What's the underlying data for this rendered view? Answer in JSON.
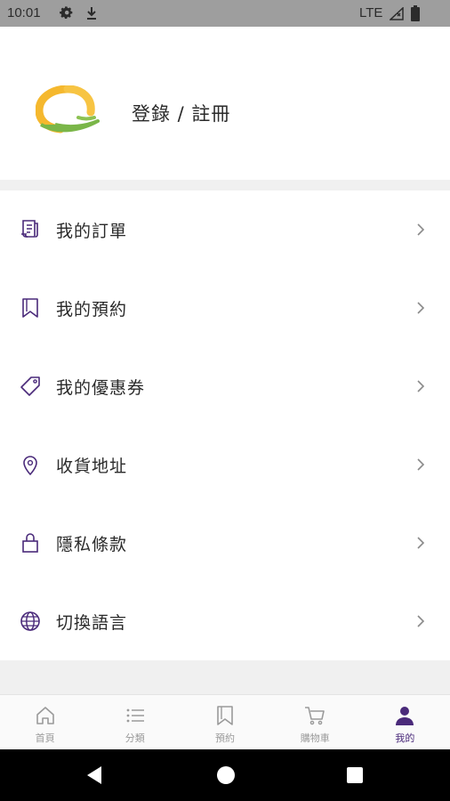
{
  "status_bar": {
    "time": "10:01",
    "network": "LTE",
    "icons": [
      "gear-icon",
      "download-icon",
      "signal-icon",
      "battery-icon"
    ]
  },
  "profile": {
    "login_label": "登錄 / 註冊"
  },
  "menu": {
    "items": [
      {
        "label": "我的訂單",
        "icon": "receipt-icon"
      },
      {
        "label": "我的預約",
        "icon": "bookmark-icon"
      },
      {
        "label": "我的優惠券",
        "icon": "tag-icon"
      },
      {
        "label": "收貨地址",
        "icon": "location-pin-icon"
      },
      {
        "label": "隱私條款",
        "icon": "lock-icon"
      },
      {
        "label": "切換語言",
        "icon": "globe-icon"
      }
    ]
  },
  "tab_bar": {
    "tabs": [
      {
        "label": "首頁",
        "icon": "home-icon"
      },
      {
        "label": "分類",
        "icon": "list-icon"
      },
      {
        "label": "預約",
        "icon": "bookmark-icon"
      },
      {
        "label": "購物車",
        "icon": "cart-icon"
      },
      {
        "label": "我的",
        "icon": "person-icon",
        "active": true
      }
    ]
  },
  "colors": {
    "accent": "#4a2a7a",
    "icon_gray": "#9a9a9a",
    "logo_yellow": "#f5b82e",
    "logo_green": "#7ab648"
  }
}
